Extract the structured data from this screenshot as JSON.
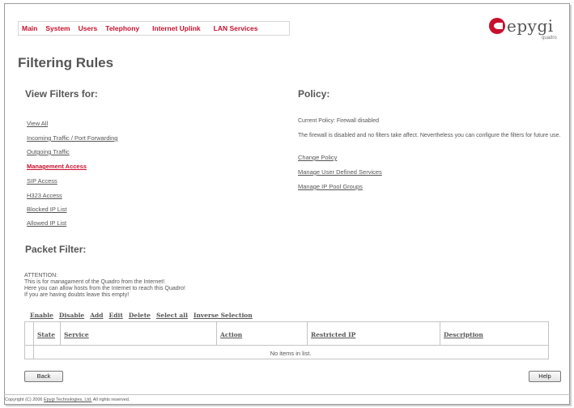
{
  "nav": {
    "items": [
      "Main",
      "System",
      "Users",
      "Telephony",
      "Internet Uplink",
      "LAN Services"
    ]
  },
  "logo": {
    "word": "epygi",
    "sub": "quadro"
  },
  "page": {
    "title": "Filtering Rules"
  },
  "view_filters": {
    "heading": "View Filters for:",
    "links": [
      {
        "label": "View All",
        "active": false
      },
      {
        "label": "Incoming Traffic / Port Forwarding",
        "active": false
      },
      {
        "label": "Outgoing Traffic",
        "active": false
      },
      {
        "label": "Management Access",
        "active": true
      },
      {
        "label": "SIP Access",
        "active": false
      },
      {
        "label": "H323 Access",
        "active": false
      },
      {
        "label": "Blocked IP List",
        "active": false
      },
      {
        "label": "Allowed IP List",
        "active": false
      }
    ]
  },
  "policy": {
    "heading": "Policy:",
    "current": "Current Policy: Firewall disabled",
    "description": "The firewall is disabled and no filters take affect. Nevertheless you can configure the filters for future use.",
    "links": [
      "Change Policy",
      "Manage User Defined Services",
      "Manage IP Pool Groups"
    ]
  },
  "packet_filter": {
    "heading": "Packet Filter:",
    "attention": [
      "ATTENTION:",
      "This is for managament of the Quadro from the Internet!",
      "Here you can allow hosts from the Internet to reach this Quadro!",
      "If you are having doubts leave this empty!"
    ],
    "actions": [
      "Enable",
      "Disable",
      "Add",
      "Edit",
      "Delete",
      "Select all",
      "Inverse Selection"
    ],
    "columns": [
      "State",
      "Service",
      "Action",
      "Restricted IP",
      "Description"
    ],
    "empty_text": "No items in list."
  },
  "buttons": {
    "back": "Back",
    "help": "Help"
  },
  "footer": {
    "prefix": "Copyright (C) 2006 ",
    "company": "Epygi Technologies, Ltd.",
    "suffix": " All rights reserved."
  },
  "colors": {
    "accent": "#c8102e",
    "text": "#555555",
    "border": "#c4c4c4"
  }
}
